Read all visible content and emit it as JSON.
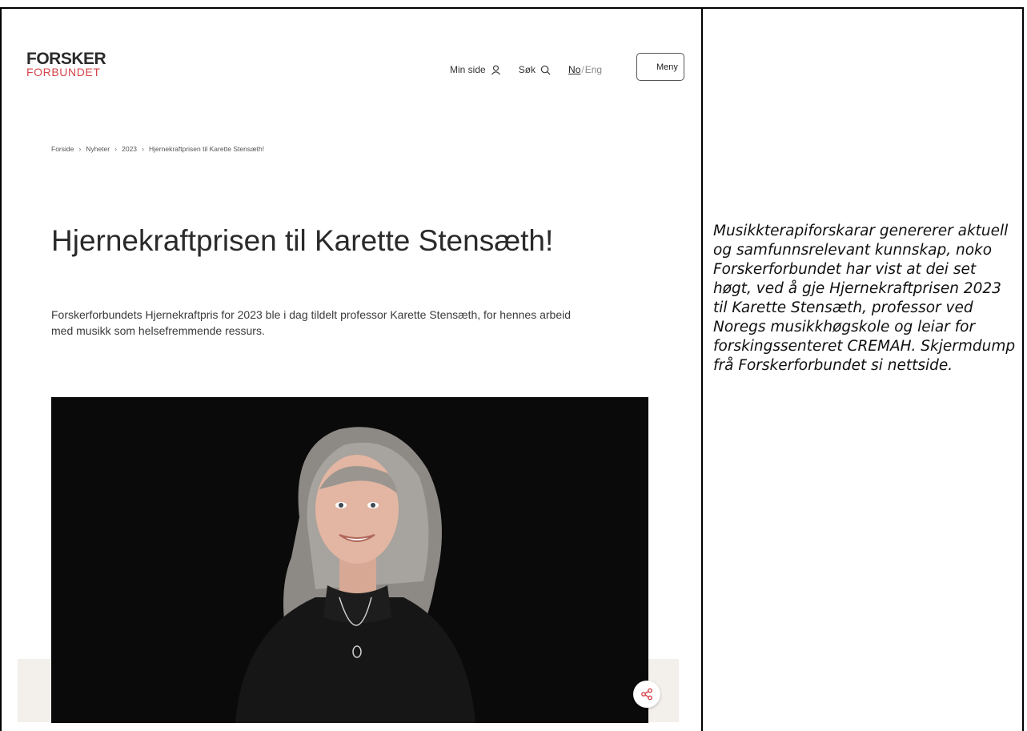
{
  "site": {
    "logo_line1": "FORSKER",
    "logo_line2": "FORBUNDET",
    "brand_color": "#d6444a"
  },
  "nav": {
    "my_page": "Min side",
    "my_page_icon": "user-icon",
    "search": "Søk",
    "search_icon": "search-icon",
    "lang_no": "No",
    "lang_sep": "/",
    "lang_en": "Eng",
    "menu": "Meny"
  },
  "breadcrumb": [
    "Forside",
    "Nyheter",
    "2023",
    "Hjernekraftprisen til Karette Stensæth!"
  ],
  "article": {
    "title": "Hjernekraftprisen til Karette Stensæth!",
    "ingress": "Forskerforbundets Hjernekraftpris for 2023 ble i dag tildelt professor Karette Stensæth, for hennes arbeid med musikk som helsefremmende ressurs.",
    "image": "portrait-photo",
    "share_icon": "share-icon"
  },
  "caption": "Musikkterapiforskarar genererer aktuell og samfunnsrelevant kunnskap, noko Forskerforbundet har vist at dei set høgt, ved å gje Hjernekraftprisen 2023 til Karette Stensæth, professor ved Noregs musikkhøgskole og leiar for forskingssenteret CREMAH. Skjermdump frå Forskerforbundet si nettside."
}
